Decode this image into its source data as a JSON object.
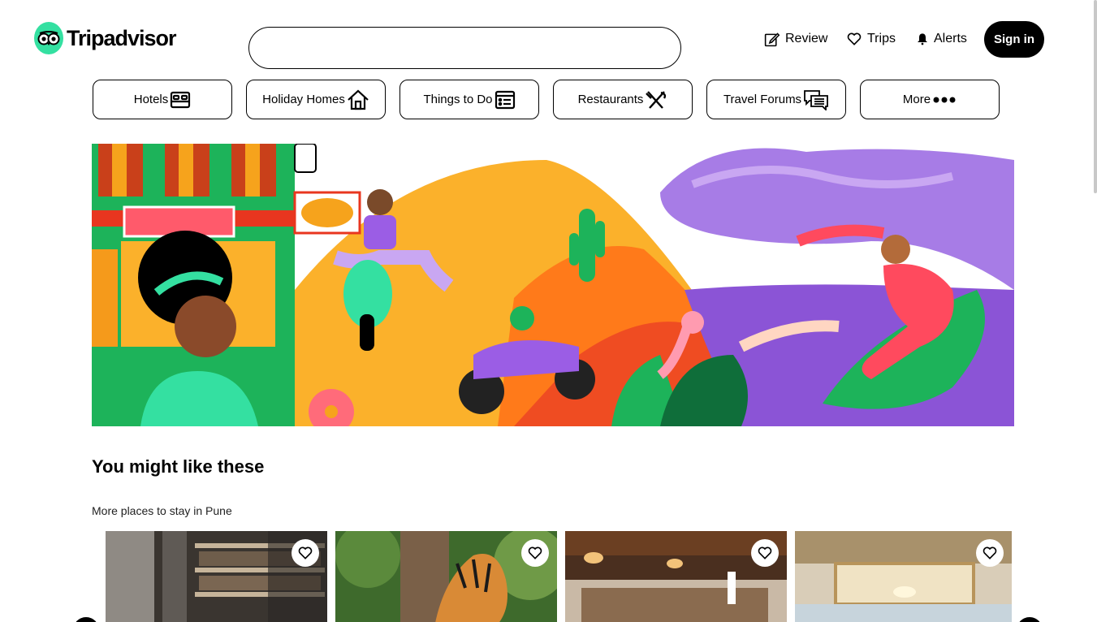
{
  "header": {
    "logo_text": "Tripadvisor",
    "search_value": "",
    "nav": {
      "review": "Review",
      "trips": "Trips",
      "alerts": "Alerts"
    },
    "signin_label": "Sign in"
  },
  "categories": [
    {
      "label": "Hotels",
      "icon": "bed-icon"
    },
    {
      "label": "Holiday Homes",
      "icon": "house-icon"
    },
    {
      "label": "Things to Do",
      "icon": "ticket-list-icon"
    },
    {
      "label": "Restaurants",
      "icon": "fork-knife-icon"
    },
    {
      "label": "Travel Forums",
      "icon": "chat-bubbles-icon"
    },
    {
      "label": "More",
      "icon": "more-dots-icon"
    }
  ],
  "hero": {
    "illustration": "travel-collage-illustration"
  },
  "section": {
    "title": "You might like these",
    "subtitle": "More places to stay in Pune"
  },
  "cards": [
    {
      "image": "hotel-bar-photo"
    },
    {
      "image": "tiger-photo"
    },
    {
      "image": "restaurant-interior-photo"
    },
    {
      "image": "banquet-hall-photo"
    }
  ],
  "colors": {
    "brand_green": "#34e0a1",
    "black": "#000000"
  }
}
